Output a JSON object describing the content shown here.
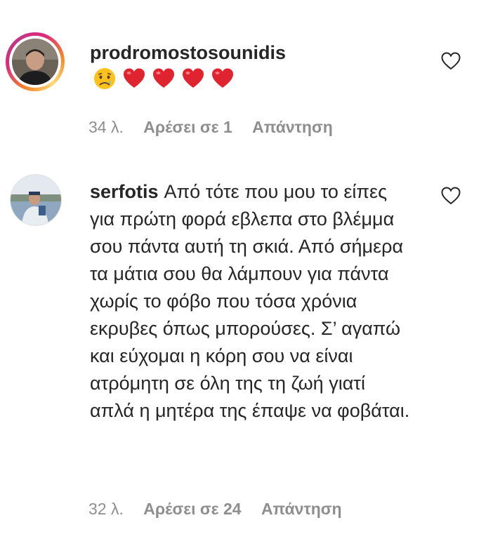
{
  "comments": [
    {
      "username": "prodromostosounidis",
      "text": "",
      "emojis": [
        "crying-face",
        "red-heart",
        "red-heart",
        "red-heart",
        "red-heart"
      ],
      "time": "34 λ.",
      "likes": "Αρέσει σε 1",
      "reply": "Απάντηση",
      "avatar_story_ring": true
    },
    {
      "username": "serfotis",
      "text": "Από τότε που μου το είπες για πρώτη φορά εβλεπα στο βλέμμα σου πάντα αυτή τη σκιά. Από σήμερα τα μάτια σου θα λάμπουν για πάντα χωρίς το φόβο που τόσα χρόνια εκρυβες όπως μπορούσες. Σ’ αγαπώ και εύχομαι η κόρη σου να είναι ατρόμητη σε όλη της τη ζωή γιατί απλά η μητέρα της έπαψε να φοβάται.",
      "time": "32 λ.",
      "likes": "Αρέσει σε 24",
      "reply": "Απάντηση",
      "avatar_story_ring": false
    }
  ],
  "icons": {
    "like": "heart-outline-icon"
  },
  "colors": {
    "text": "#262626",
    "secondary": "#8e8e8e",
    "heart": "#ed4956"
  }
}
